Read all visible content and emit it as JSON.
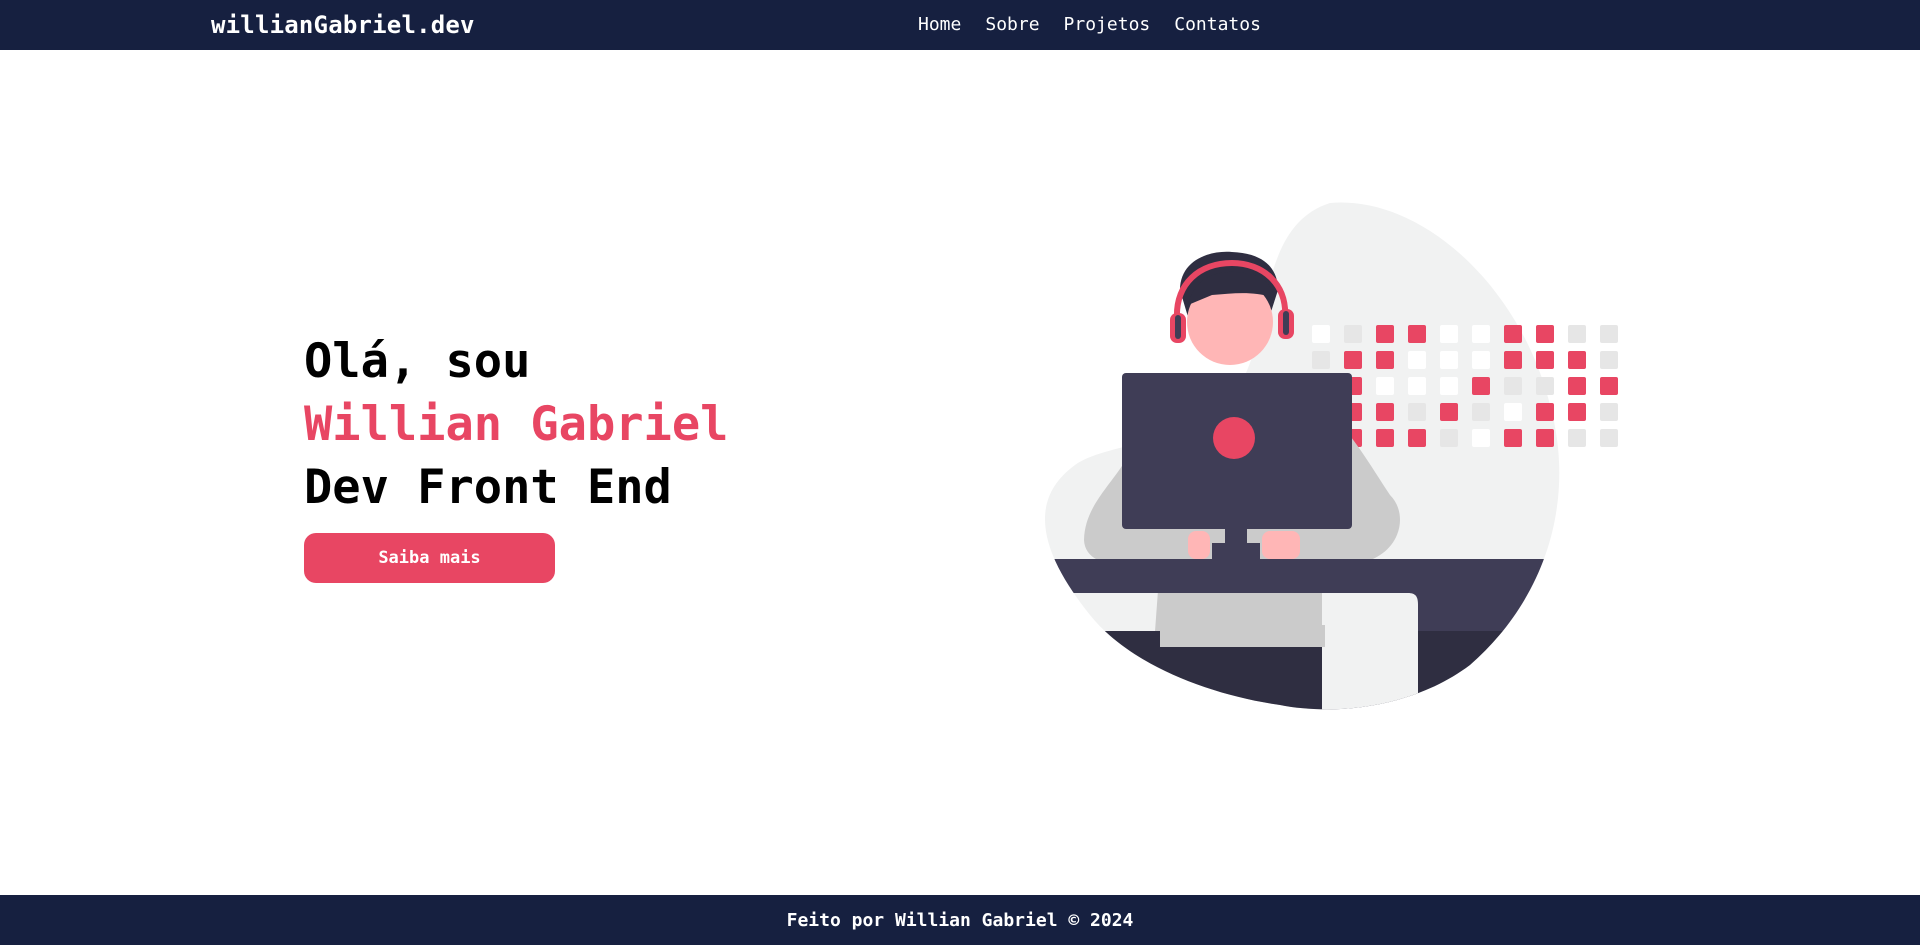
{
  "header": {
    "brand": "willianGabriel.dev",
    "nav": [
      {
        "label": "Home"
      },
      {
        "label": "Sobre"
      },
      {
        "label": "Projetos"
      },
      {
        "label": "Contatos"
      }
    ]
  },
  "hero": {
    "greeting": "Olá, sou",
    "name": "Willian Gabriel",
    "role": "Dev Front End",
    "cta_label": "Saiba mais"
  },
  "footer": {
    "text": "Feito por Willian Gabriel © 2024"
  },
  "colors": {
    "navy": "#162040",
    "accent": "#e84663",
    "dark_slate": "#3f3d56",
    "light_gray": "#f1f2f2",
    "mid_gray": "#cbcbcb"
  },
  "icons": {
    "illustration": "developer-with-headphones-illustration"
  }
}
